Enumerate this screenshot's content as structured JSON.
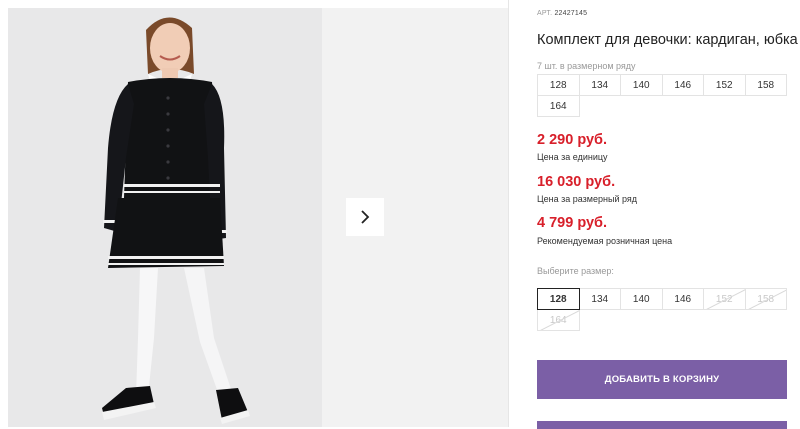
{
  "product": {
    "art_label": "АРТ.",
    "art_number": "22427145",
    "title": "Комплект для девочки: кардиган, юбка",
    "pack_note": "7 шт. в размерном ряду",
    "pack_sizes": [
      "128",
      "134",
      "140",
      "146",
      "152",
      "158",
      "164"
    ],
    "prices": [
      {
        "value": "2 290 руб.",
        "caption": "Цена за единицу"
      },
      {
        "value": "16 030 руб.",
        "caption": "Цена за размерный ряд"
      },
      {
        "value": "4 799 руб.",
        "caption": "Рекомендуемая розничная цена"
      }
    ],
    "choose_label": "Выберите размер:",
    "sizes": [
      {
        "label": "128",
        "state": "selected"
      },
      {
        "label": "134",
        "state": "available"
      },
      {
        "label": "140",
        "state": "available"
      },
      {
        "label": "146",
        "state": "available"
      },
      {
        "label": "152",
        "state": "disabled"
      },
      {
        "label": "158",
        "state": "disabled"
      },
      {
        "label": "164",
        "state": "disabled"
      }
    ],
    "add_to_cart": "ДОБАВИТЬ В КОРЗИНУ"
  },
  "gallery": {
    "next_icon": "chevron-right-icon"
  },
  "colors": {
    "price": "#d81f2a",
    "button": "#7b5fa6"
  }
}
